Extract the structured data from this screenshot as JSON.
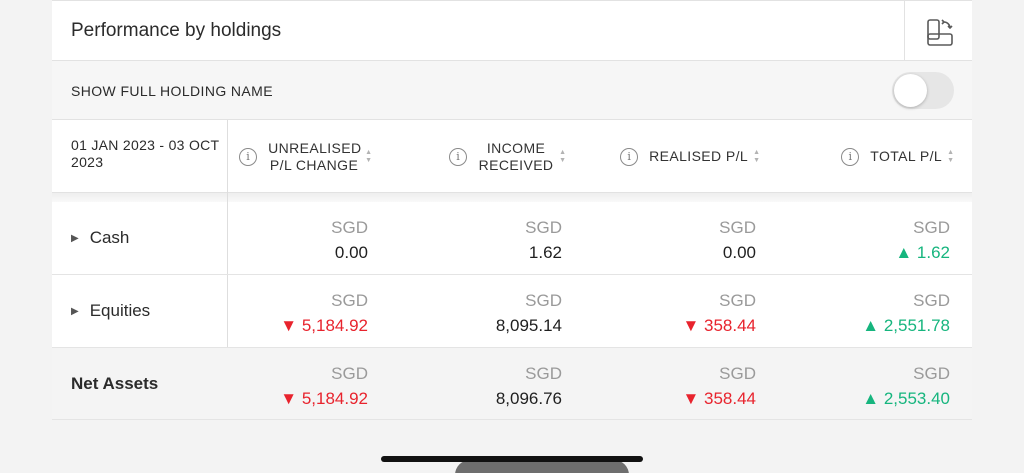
{
  "header": {
    "title": "Performance by holdings",
    "rotate_icon": "rotate-screen-icon"
  },
  "option": {
    "label": "SHOW FULL HOLDING NAME",
    "toggle_on": false
  },
  "period": "01 JAN 2023 - 03 OCT 2023",
  "columns": [
    {
      "label": "UNREALISED P/L CHANGE",
      "info_icon": "i"
    },
    {
      "label": "INCOME RECEIVED",
      "info_icon": "i"
    },
    {
      "label": "REALISED P/L",
      "info_icon": "i"
    },
    {
      "label": "TOTAL P/L",
      "info_icon": "i"
    }
  ],
  "sort_glyph": {
    "up": "▲",
    "down": "▼"
  },
  "rows": [
    {
      "name": "Cash",
      "expand_icon": "▶",
      "cells": [
        {
          "currency": "SGD",
          "amount": "0.00"
        },
        {
          "currency": "SGD",
          "amount": "1.62"
        },
        {
          "currency": "SGD",
          "amount": "0.00"
        },
        {
          "currency": "SGD",
          "amount": "▲ 1.62"
        }
      ]
    },
    {
      "name": "Equities",
      "expand_icon": "▶",
      "cells": [
        {
          "currency": "SGD",
          "amount": "▼ 5,184.92"
        },
        {
          "currency": "SGD",
          "amount": "8,095.14"
        },
        {
          "currency": "SGD",
          "amount": "▼ 358.44"
        },
        {
          "currency": "SGD",
          "amount": "▲ 2,551.78"
        }
      ]
    },
    {
      "name": "Net Assets",
      "cells": [
        {
          "currency": "SGD",
          "amount": "▼ 5,184.92"
        },
        {
          "currency": "SGD",
          "amount": "8,096.76"
        },
        {
          "currency": "SGD",
          "amount": "▼ 358.44"
        },
        {
          "currency": "SGD",
          "amount": "▲ 2,553.40"
        }
      ]
    }
  ],
  "colors": {
    "negative": "#e8232d",
    "positive": "#16b57e",
    "currency": "#9a9a9a"
  }
}
